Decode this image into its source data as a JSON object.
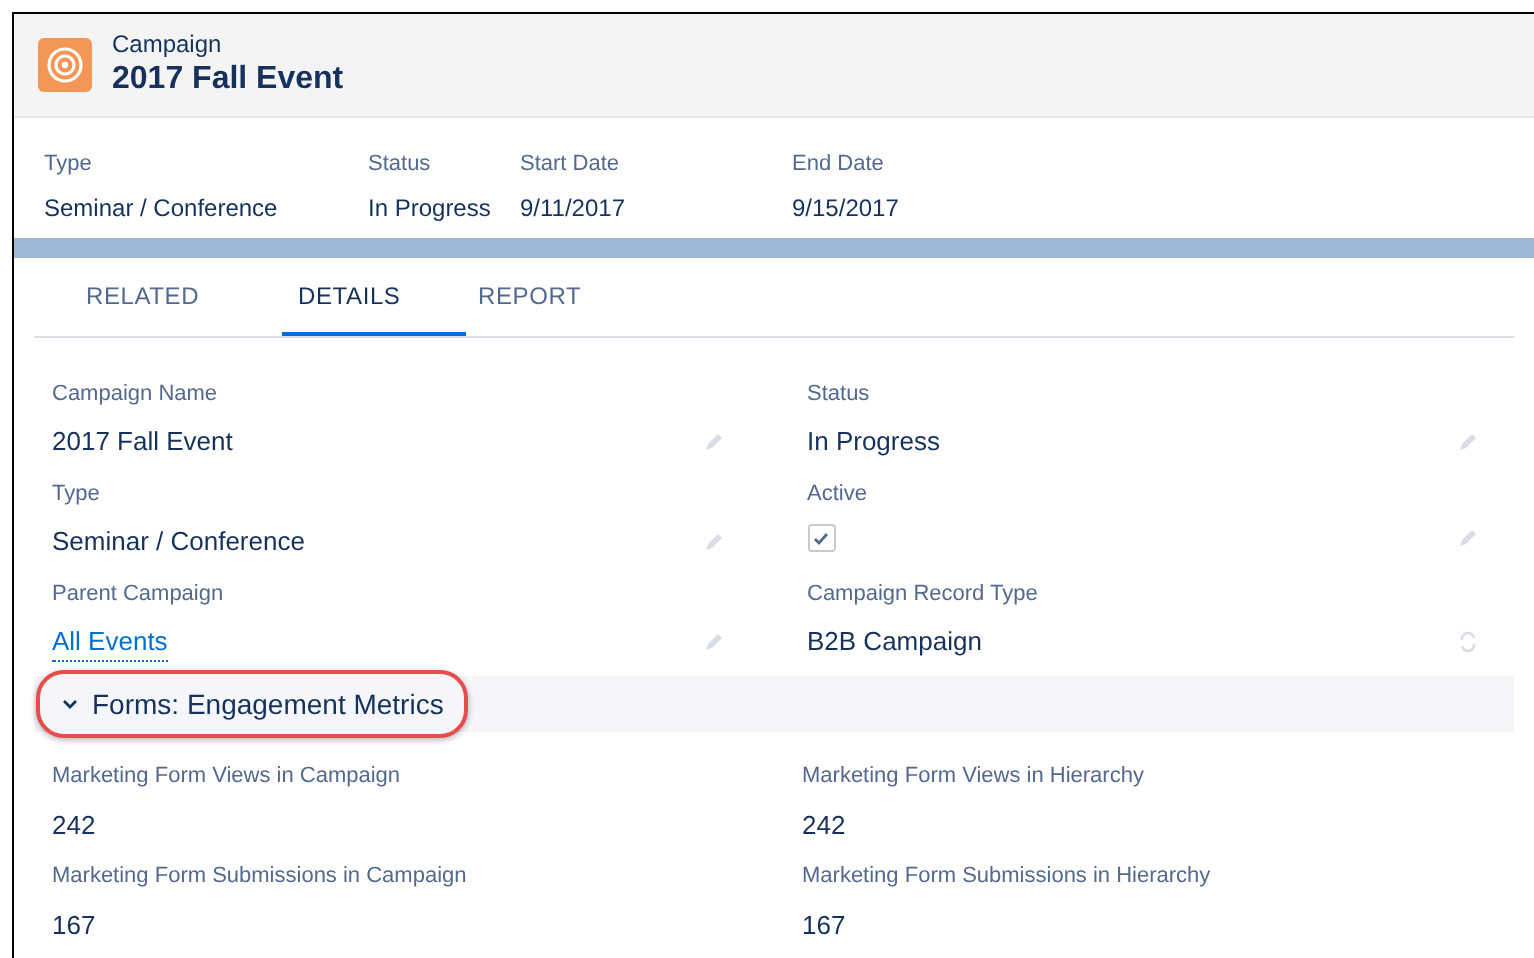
{
  "header": {
    "object_type": "Campaign",
    "title": "2017 Fall Event"
  },
  "highlights": [
    {
      "label": "Type",
      "value": "Seminar / Conference"
    },
    {
      "label": "Status",
      "value": "In Progress"
    },
    {
      "label": "Start Date",
      "value": "9/11/2017"
    },
    {
      "label": "End Date",
      "value": "9/15/2017"
    }
  ],
  "tabs": [
    {
      "label": "RELATED",
      "selected": false
    },
    {
      "label": "DETAILS",
      "selected": true
    },
    {
      "label": "REPORT",
      "selected": false
    }
  ],
  "fields": [
    {
      "label": "Campaign Name",
      "kind": "text",
      "value": "2017 Fall Event"
    },
    {
      "label": "Status",
      "kind": "text",
      "value": "In Progress"
    },
    {
      "label": "Type",
      "kind": "text",
      "value": "Seminar / Conference"
    },
    {
      "label": "Active",
      "kind": "checkbox",
      "checked": true
    },
    {
      "label": "Parent Campaign",
      "kind": "link",
      "value": "All Events"
    },
    {
      "label": "Campaign Record Type",
      "kind": "recordtype",
      "value": "B2B Campaign"
    }
  ],
  "section": {
    "title": "Forms: Engagement Metrics",
    "expanded": true,
    "highlighted": true,
    "fields": [
      {
        "label": "Marketing Form Views in Campaign",
        "value": "242"
      },
      {
        "label": "Marketing Form Views in Hierarchy",
        "value": "242"
      },
      {
        "label": "Marketing Form Submissions in Campaign",
        "value": "167"
      },
      {
        "label": "Marketing Form Submissions in Hierarchy",
        "value": "167"
      }
    ]
  }
}
